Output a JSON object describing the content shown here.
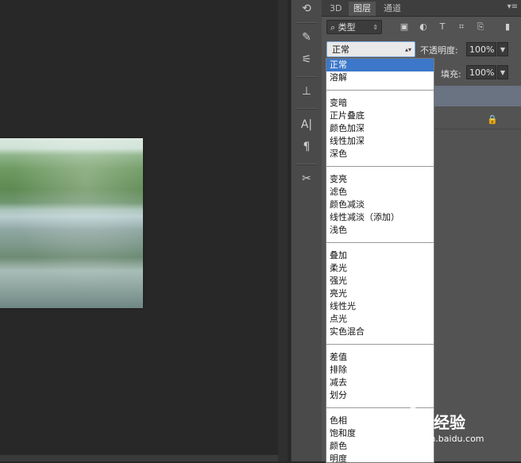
{
  "tabs": [
    {
      "label": "3D"
    },
    {
      "label": "图层"
    },
    {
      "label": "通道"
    }
  ],
  "filter": {
    "kind_label": "类型",
    "icons": [
      "image-filter-icon",
      "adjustment-filter-icon",
      "type-filter-icon",
      "shape-filter-icon",
      "smartobject-filter-icon",
      "filter-toggle-icon"
    ]
  },
  "blend_mode": {
    "selected": "正常"
  },
  "opacity": {
    "label": "不透明度:",
    "value": "100%"
  },
  "fill": {
    "label": "填充:",
    "value": "100%"
  },
  "blend_groups": [
    [
      "正常",
      "溶解"
    ],
    [
      "变暗",
      "正片叠底",
      "颜色加深",
      "线性加深",
      "深色"
    ],
    [
      "变亮",
      "滤色",
      "颜色减淡",
      "线性减淡（添加）",
      "浅色"
    ],
    [
      "叠加",
      "柔光",
      "强光",
      "亮光",
      "线性光",
      "点光",
      "实色混合"
    ],
    [
      "差值",
      "排除",
      "减去",
      "划分"
    ],
    [
      "色相",
      "饱和度",
      "颜色",
      "明度"
    ]
  ],
  "watermark": {
    "brand_text": "经验",
    "url": "jingyan.baidu.com"
  },
  "colors": {
    "selected_item": "#3c77c9",
    "panel_bg": "#535353",
    "canvas_bg": "#282828"
  }
}
